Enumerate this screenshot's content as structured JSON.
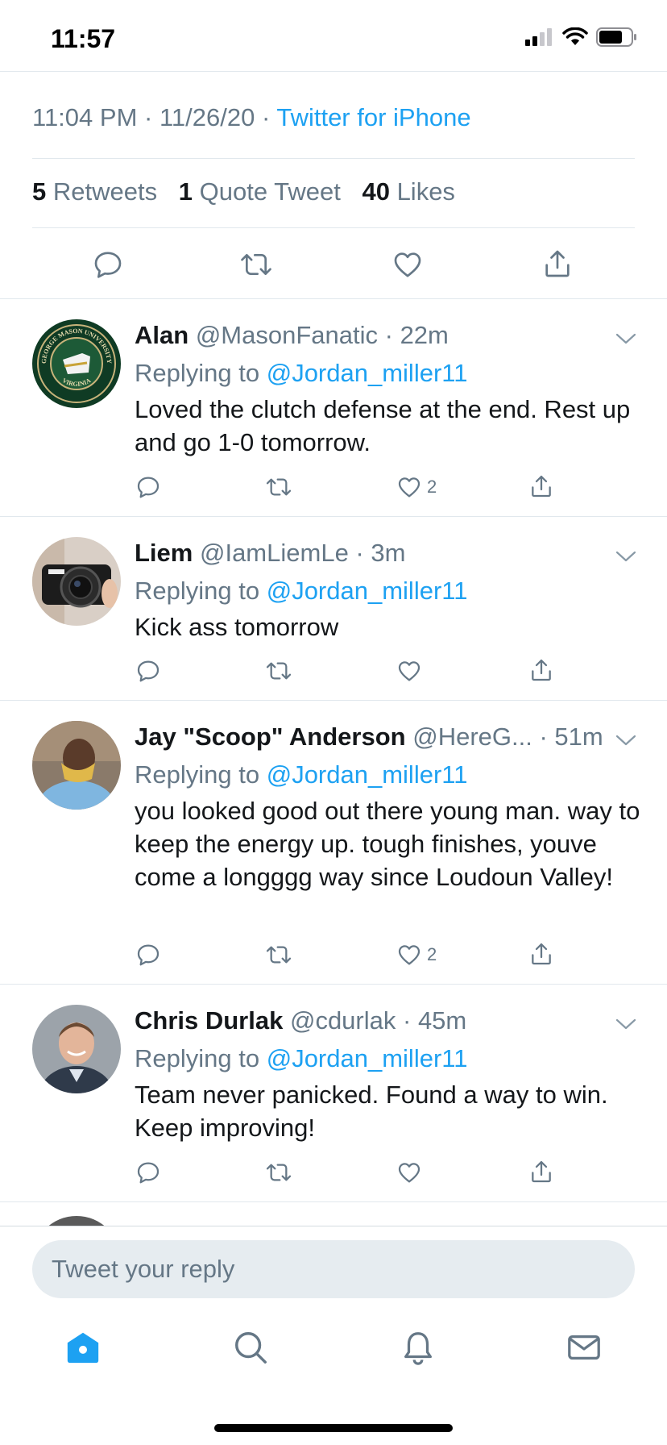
{
  "status_bar": {
    "time": "11:57"
  },
  "tweet": {
    "time": "11:04 PM",
    "date": "11/26/20",
    "source": "Twitter for iPhone",
    "retweets_count": "5",
    "retweets_label": "Retweets",
    "quotes_count": "1",
    "quotes_label": "Quote Tweet",
    "likes_count": "40",
    "likes_label": "Likes"
  },
  "replies": [
    {
      "name": "Alan",
      "handle": "@MasonFanatic",
      "time": "22m",
      "replying_to_label": "Replying to",
      "replying_to": "@Jordan_miller11",
      "text": "Loved the clutch defense at the end. Rest up and go 1-0 tomorrow.",
      "like_count": "2",
      "avatar_seal_top": "GEORGE MASON UNIVERSITY",
      "avatar_seal_bottom": "VIRGINIA"
    },
    {
      "name": "Liem",
      "handle": "@IamLiemLe",
      "time": "3m",
      "replying_to_label": "Replying to",
      "replying_to": "@Jordan_miller11",
      "text": "Kick ass tomorrow",
      "like_count": ""
    },
    {
      "name": "Jay \"Scoop\" Anderson",
      "handle": "@HereG...",
      "time": "51m",
      "replying_to_label": "Replying to",
      "replying_to": "@Jordan_miller11",
      "text": "you looked good out there young man. way to keep the energy up. tough finishes, youve come a longggg way since Loudoun Valley!",
      "like_count": "2"
    },
    {
      "name": "Chris Durlak",
      "handle": "@cdurlak",
      "time": "45m",
      "replying_to_label": "Replying to",
      "replying_to": "@Jordan_miller11",
      "text": "Team never panicked. Found a way to win. Keep improving!",
      "like_count": ""
    }
  ],
  "composer": {
    "placeholder": "Tweet your reply"
  },
  "icons": {
    "reply": "reply-icon",
    "retweet": "retweet-icon",
    "like": "heart-icon",
    "share": "share-icon",
    "home": "home-icon",
    "search": "search-icon",
    "notifications": "bell-icon",
    "messages": "mail-icon"
  },
  "colors": {
    "accent": "#1da1f2",
    "muted": "#657786",
    "text": "#14171a",
    "divider": "#e1e8ed"
  }
}
